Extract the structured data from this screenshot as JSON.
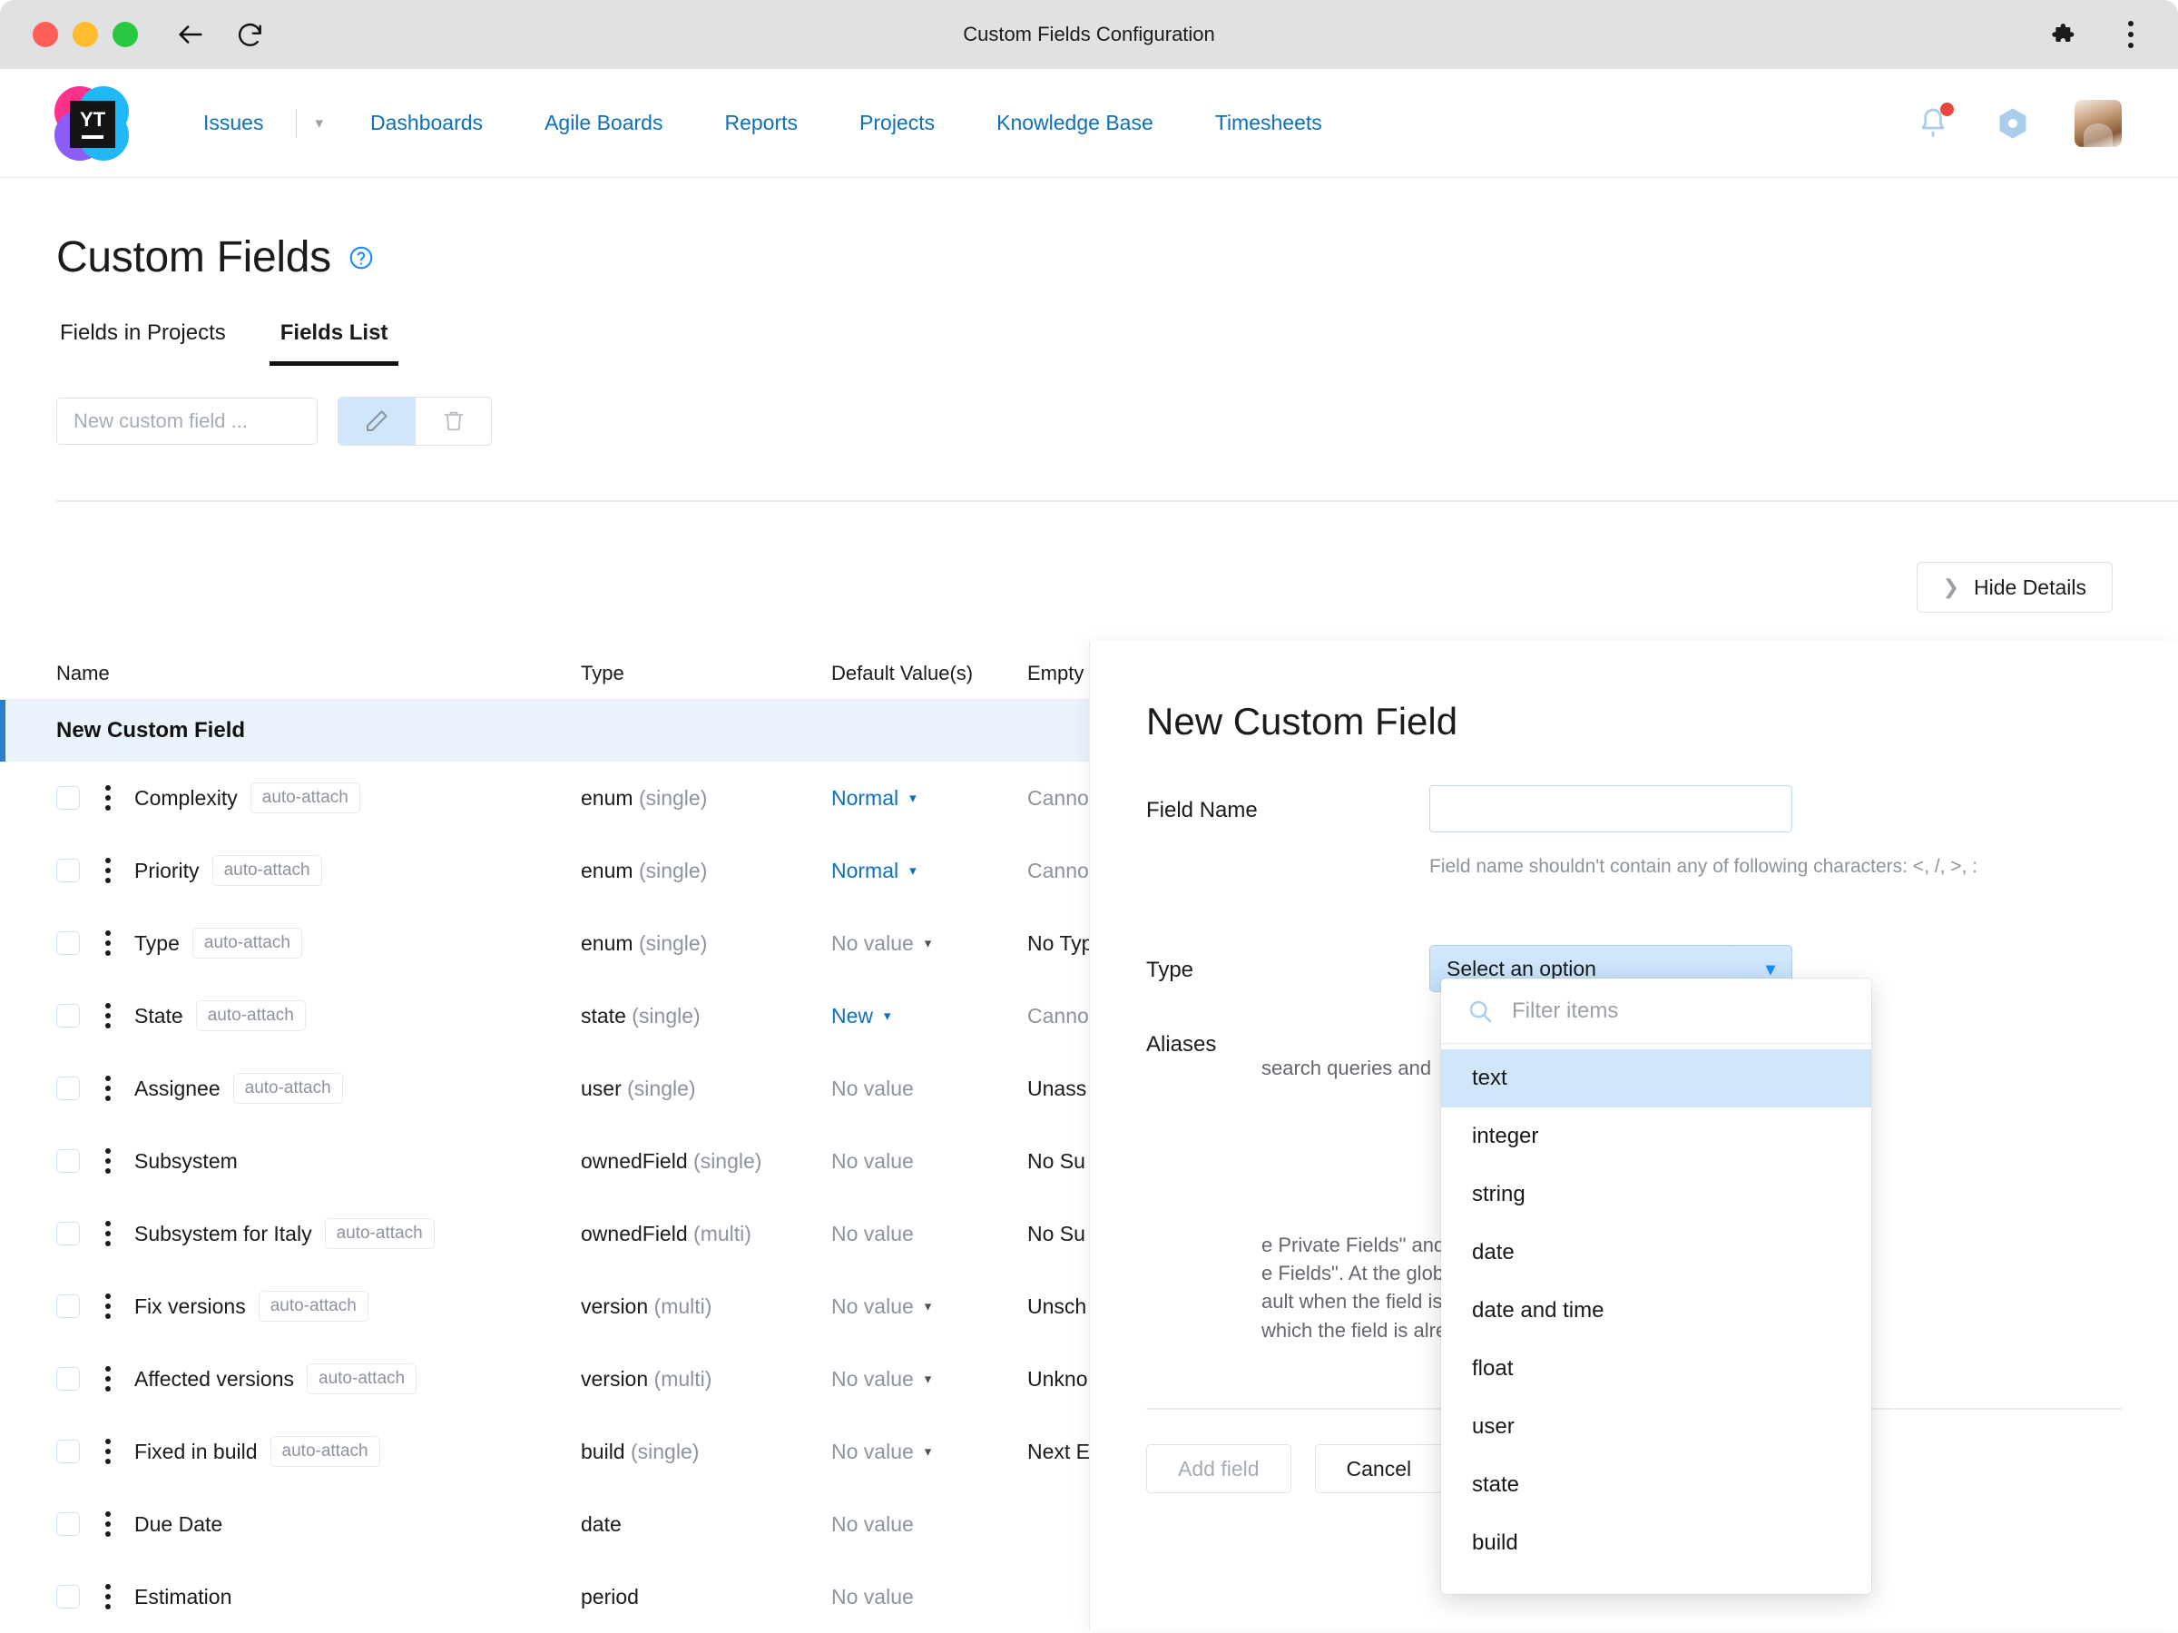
{
  "browser": {
    "title": "Custom Fields Configuration",
    "back_icon": "back-arrow-icon",
    "reload_icon": "reload-icon",
    "extensions_icon": "puzzle-piece-icon",
    "menu_icon": "kebab-menu-icon"
  },
  "header": {
    "logo_text": "YT",
    "nav": [
      {
        "label": "Issues"
      },
      {
        "label": "Dashboards"
      },
      {
        "label": "Agile Boards"
      },
      {
        "label": "Reports"
      },
      {
        "label": "Projects"
      },
      {
        "label": "Knowledge Base"
      },
      {
        "label": "Timesheets"
      }
    ],
    "notifications_icon": "bell-icon",
    "settings_icon": "gear-icon",
    "avatar_alt": "user-avatar"
  },
  "page": {
    "title": "Custom Fields",
    "help_icon": "question-circle-icon",
    "tabs": [
      {
        "label": "Fields in Projects",
        "active": false
      },
      {
        "label": "Fields List",
        "active": true
      }
    ],
    "toolbar": {
      "new_field_placeholder": "New custom field ...",
      "edit_icon": "pencil-icon",
      "delete_icon": "trash-icon"
    },
    "hide_details_label": "Hide Details",
    "hide_details_icon": "chevron-right-icon"
  },
  "table": {
    "columns": [
      "Name",
      "Type",
      "Default Value(s)",
      "Empty"
    ],
    "new_row_label": "New Custom Field",
    "rows": [
      {
        "name": "Complexity",
        "tag": "auto-attach",
        "type": "enum",
        "cardinality": "(single)",
        "default": "Normal",
        "default_style": "link",
        "default_caret": true,
        "empty": "Cannot",
        "empty_style": "muted"
      },
      {
        "name": "Priority",
        "tag": "auto-attach",
        "type": "enum",
        "cardinality": "(single)",
        "default": "Normal",
        "default_style": "link",
        "default_caret": true,
        "empty": "Cannot",
        "empty_style": "muted"
      },
      {
        "name": "Type",
        "tag": "auto-attach",
        "type": "enum",
        "cardinality": "(single)",
        "default": "No value",
        "default_style": "muted",
        "default_caret": true,
        "empty": "No Typ",
        "empty_style": "dark"
      },
      {
        "name": "State",
        "tag": "auto-attach",
        "type": "state",
        "cardinality": "(single)",
        "default": "New",
        "default_style": "link",
        "default_caret": true,
        "empty": "Cannot",
        "empty_style": "muted"
      },
      {
        "name": "Assignee",
        "tag": "auto-attach",
        "type": "user",
        "cardinality": "(single)",
        "default": "No value",
        "default_style": "muted",
        "default_caret": false,
        "empty": "Unass",
        "empty_style": "dark"
      },
      {
        "name": "Subsystem",
        "tag": "",
        "type": "ownedField",
        "cardinality": "(single)",
        "default": "No value",
        "default_style": "muted",
        "default_caret": false,
        "empty": "No Su",
        "empty_style": "dark"
      },
      {
        "name": "Subsystem for Italy",
        "tag": "auto-attach",
        "type": "ownedField",
        "cardinality": "(multi)",
        "default": "No value",
        "default_style": "muted",
        "default_caret": false,
        "empty": "No Su",
        "empty_style": "dark"
      },
      {
        "name": "Fix versions",
        "tag": "auto-attach",
        "type": "version",
        "cardinality": "(multi)",
        "default": "No value",
        "default_style": "muted",
        "default_caret": true,
        "empty": "Unsch",
        "empty_style": "dark"
      },
      {
        "name": "Affected versions",
        "tag": "auto-attach",
        "type": "version",
        "cardinality": "(multi)",
        "default": "No value",
        "default_style": "muted",
        "default_caret": true,
        "empty": "Unkno",
        "empty_style": "dark"
      },
      {
        "name": "Fixed in build",
        "tag": "auto-attach",
        "type": "build",
        "cardinality": "(single)",
        "default": "No value",
        "default_style": "muted",
        "default_caret": true,
        "empty": "Next E",
        "empty_style": "dark"
      },
      {
        "name": "Due Date",
        "tag": "",
        "type": "date",
        "cardinality": "",
        "default": "No value",
        "default_style": "muted",
        "default_caret": false,
        "empty": "",
        "empty_style": "dark"
      },
      {
        "name": "Estimation",
        "tag": "",
        "type": "period",
        "cardinality": "",
        "default": "No value",
        "default_style": "muted",
        "default_caret": false,
        "empty": "",
        "empty_style": "dark"
      }
    ]
  },
  "panel": {
    "title": "New Custom Field",
    "field_name_label": "Field Name",
    "field_name_value": "",
    "field_name_hint": "Field name shouldn't contain any of following characters: <, /, >, :",
    "type_label": "Type",
    "type_value": "Select an option",
    "aliases_label": "Aliases",
    "desc_fragment_1": "search queries and",
    "desc_fragment_2": "e Private Fields\" and\ne Fields\". At the global\nault when the field is\nwhich the field is already",
    "add_field_label": "Add field",
    "cancel_label": "Cancel"
  },
  "dropdown": {
    "filter_placeholder": "Filter items",
    "search_icon": "search-icon",
    "options": [
      {
        "label": "text",
        "highlighted": true
      },
      {
        "label": "integer",
        "highlighted": false
      },
      {
        "label": "string",
        "highlighted": false
      },
      {
        "label": "date",
        "highlighted": false
      },
      {
        "label": "date and time",
        "highlighted": false
      },
      {
        "label": "float",
        "highlighted": false
      },
      {
        "label": "user",
        "highlighted": false
      },
      {
        "label": "state",
        "highlighted": false
      },
      {
        "label": "build",
        "highlighted": false
      }
    ]
  },
  "colors": {
    "accent_blue": "#0f6fb8",
    "selected_row": "#eaf3fb",
    "highlight": "#cfe6fb",
    "muted_text": "#8d939c"
  }
}
